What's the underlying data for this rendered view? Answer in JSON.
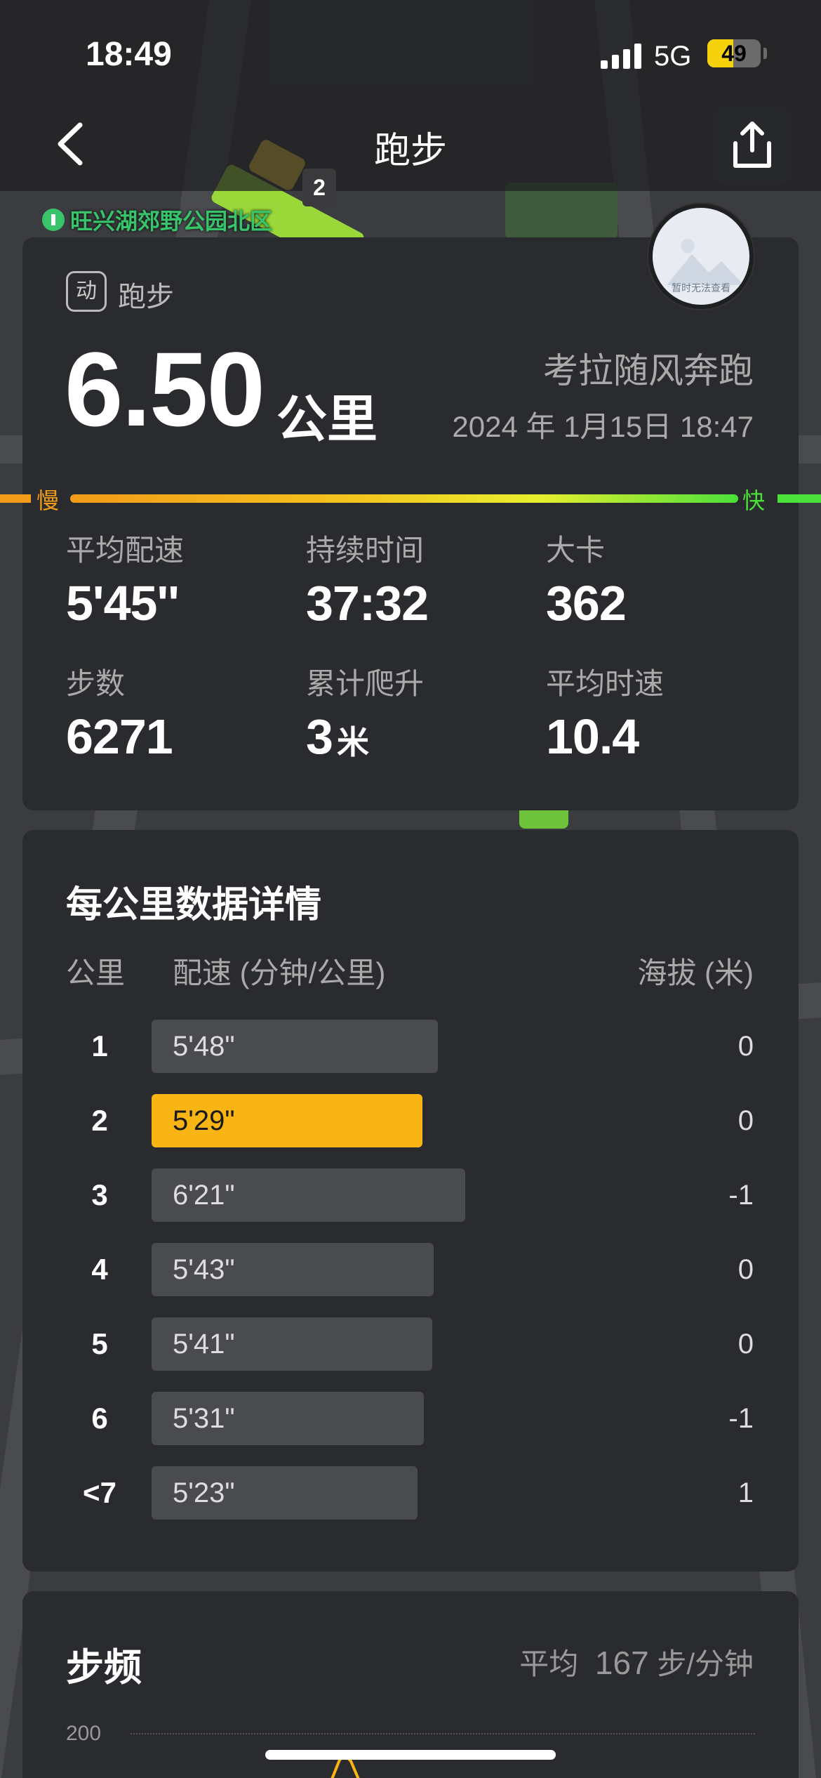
{
  "status": {
    "time": "18:49",
    "network": "5G",
    "battery": "49",
    "battery_level": 0.49
  },
  "nav": {
    "title": "跑步",
    "back_icon": "chevron-left-icon",
    "share_icon": "share-icon"
  },
  "map": {
    "marker": "2",
    "park_label": "旺兴湖郊野公园北区"
  },
  "avatar": {
    "caption": "暂时无法查看"
  },
  "summary": {
    "sport_icon_text": "动",
    "sport_label": "跑步",
    "distance": "6.50",
    "distance_unit": "公里",
    "user_name": "考拉随风奔跑",
    "date_time": "2024 年 1月15日 18:47",
    "pace_slow": "慢",
    "pace_fast": "快",
    "stats": [
      {
        "label": "平均配速",
        "value": "5'45''",
        "unit": ""
      },
      {
        "label": "持续时间",
        "value": "37:32",
        "unit": ""
      },
      {
        "label": "大卡",
        "value": "362",
        "unit": ""
      },
      {
        "label": "步数",
        "value": "6271",
        "unit": ""
      },
      {
        "label": "累计爬升",
        "value": "3",
        "unit": "米"
      },
      {
        "label": "平均时速",
        "value": "10.4",
        "unit": ""
      }
    ]
  },
  "splits": {
    "title": "每公里数据详情",
    "col_km": "公里",
    "col_pace": "配速 (分钟/公里)",
    "col_alt": "海拔 (米)",
    "rows": [
      {
        "km": "1",
        "pace": "5'48\"",
        "pace_sec": 348,
        "alt": "0",
        "best": false
      },
      {
        "km": "2",
        "pace": "5'29\"",
        "pace_sec": 329,
        "alt": "0",
        "best": true
      },
      {
        "km": "3",
        "pace": "6'21\"",
        "pace_sec": 381,
        "alt": "-1",
        "best": false
      },
      {
        "km": "4",
        "pace": "5'43\"",
        "pace_sec": 343,
        "alt": "0",
        "best": false
      },
      {
        "km": "5",
        "pace": "5'41\"",
        "pace_sec": 341,
        "alt": "0",
        "best": false
      },
      {
        "km": "6",
        "pace": "5'31\"",
        "pace_sec": 331,
        "alt": "-1",
        "best": false
      },
      {
        "km": "<7",
        "pace": "5'23\"",
        "pace_sec": 323,
        "alt": "1",
        "best": false
      }
    ]
  },
  "cadence": {
    "title": "步频",
    "avg_label": "平均",
    "avg_value": "167",
    "avg_unit": "步/分钟",
    "tick_200": "200"
  },
  "colors": {
    "accent": "#f8b514",
    "slow": "#f29c1a",
    "fast": "#4be03a",
    "card_bg": "#2a2b2e"
  }
}
